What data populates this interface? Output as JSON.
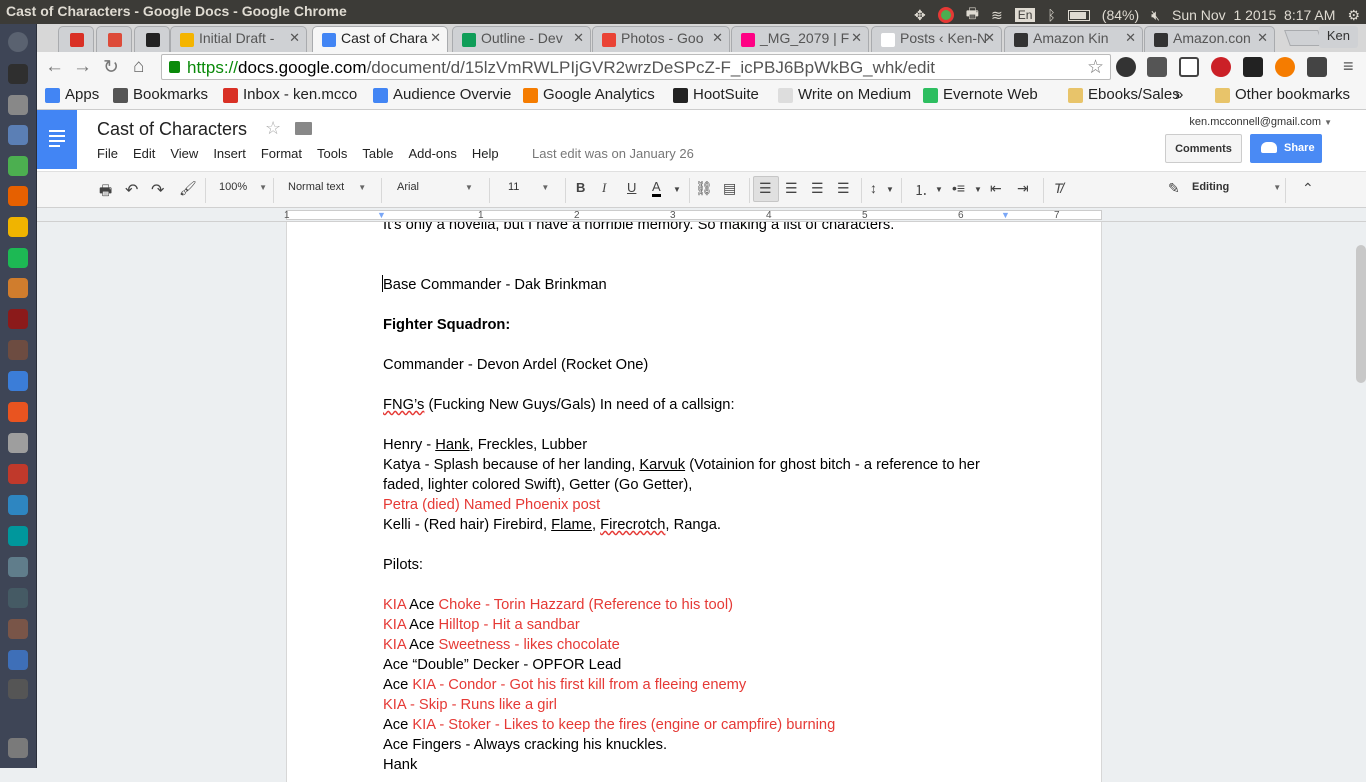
{
  "system_bar": {
    "window_title": "Cast of Characters - Google Docs - Google Chrome",
    "keyboard_layout": "En",
    "battery": "(84%)",
    "datetime": "Sun Nov  1 2015  8:17 AM",
    "user": "Ken"
  },
  "launcher": {
    "icons": [
      "ubuntu-dash-icon",
      "terminal-icon",
      "camera-icon",
      "files-icon",
      "chrome-icon",
      "firefox-icon",
      "pencil-app-icon",
      "spotify-icon",
      "sublime-icon",
      "scrivener-icon",
      "books-icon",
      "document-icon",
      "software-center-icon",
      "settings-icon",
      "calibre-icon",
      "graph-icon",
      "arduino-icon",
      "screenshot-icon",
      "camera-app-icon",
      "brush-icon",
      "notes-icon",
      "small-app-icon",
      "trash-icon"
    ],
    "colors": [
      "#5a6270",
      "#2f2f2f",
      "#888888",
      "#5b7fb5",
      "#4caf50",
      "#e66000",
      "#f0b400",
      "#1db954",
      "#d07d2d",
      "#8b1a1a",
      "#6d4c41",
      "#3b7dd8",
      "#e95420",
      "#9e9e9e",
      "#c0392b",
      "#2e86c1",
      "#00979c",
      "#607d8b",
      "#455a64",
      "#795548",
      "#3e6fb8",
      "#555555",
      "#7a7a7a"
    ]
  },
  "browser": {
    "tabs": [
      {
        "label": "",
        "favicon": "gmail-icon",
        "color": "#d93025"
      },
      {
        "label": "",
        "favicon": "google-plus-icon",
        "color": "#dd4b39"
      },
      {
        "label": "",
        "favicon": "owl-icon",
        "color": "#222222"
      },
      {
        "label": "Initial Draft -",
        "favicon": "drive-icon",
        "color": "#f4b400"
      },
      {
        "label": "Cast of Chara",
        "favicon": "docs-icon",
        "color": "#4285f4"
      },
      {
        "label": "Outline - Dev",
        "favicon": "sheets-icon",
        "color": "#0f9d58"
      },
      {
        "label": "Photos - Goo",
        "favicon": "photos-icon",
        "color": "#ea4335"
      },
      {
        "label": "_MG_2079 | F",
        "favicon": "flickr-icon",
        "color": "#ff0084"
      },
      {
        "label": "Posts ‹ Ken-N",
        "favicon": "page-icon",
        "color": "#ffffff"
      },
      {
        "label": "Amazon Kin",
        "favicon": "amazon-icon",
        "color": "#333333"
      },
      {
        "label": "Amazon.con",
        "favicon": "amazon-icon",
        "color": "#333333"
      }
    ],
    "url_scheme": "https://",
    "url_host": "docs.google.com",
    "url_path": "/document/d/15lzVmRWLPIjGVR2wrzDeSPcZ-F_icPBJ6BpWkBG_whk/edit",
    "bookmarks": [
      {
        "label": "Apps",
        "icon": "apps-grid-icon",
        "color": "#4285f4"
      },
      {
        "label": "Bookmarks",
        "icon": "star-icon",
        "color": "#555555"
      },
      {
        "label": "Inbox - ken.mcco",
        "icon": "gmail-icon",
        "color": "#d93025"
      },
      {
        "label": "Audience Overvie",
        "icon": "google-icon",
        "color": "#4285f4"
      },
      {
        "label": "Google Analytics",
        "icon": "analytics-icon",
        "color": "#f57c00"
      },
      {
        "label": "HootSuite",
        "icon": "hootsuite-icon",
        "color": "#222222"
      },
      {
        "label": "Write on Medium",
        "icon": "page-icon",
        "color": "#dddddd"
      },
      {
        "label": "Evernote Web",
        "icon": "evernote-icon",
        "color": "#2dbe60"
      },
      {
        "label": "Ebooks/Sales",
        "icon": "folder-icon",
        "color": "#e8c46a"
      }
    ],
    "overflow_label": "»",
    "other_bookmarks": "Other bookmarks"
  },
  "docs": {
    "title": "Cast of Characters",
    "menu": [
      "File",
      "Edit",
      "View",
      "Insert",
      "Format",
      "Tools",
      "Table",
      "Add-ons",
      "Help"
    ],
    "last_edit": "Last edit was on January 26",
    "account": "ken.mcconnell@gmail.com",
    "comments_label": "Comments",
    "share_label": "Share",
    "zoom": "100%",
    "style": "Normal text",
    "font": "Arial",
    "font_size": "11",
    "mode": "Editing",
    "ruler_numbers": [
      "1",
      "1",
      "2",
      "3",
      "4",
      "5",
      "6",
      "7"
    ],
    "accent": "#4285f4"
  },
  "document": {
    "l1": "It’s only a novella, but I have a horrible memory. So making a list of characters.",
    "l2": "Base Commander - Dak Brinkman",
    "l3": "Fighter Squadron:",
    "l4": "Commander - Devon Ardel (Rocket One)",
    "l5a": "FNG’s",
    "l5b": " (Fucking New Guys/Gals) In need of a callsign:",
    "l6a": "Henry - ",
    "l6b": "Hank",
    "l6c": ", Freckles, Lubber",
    "l7a": "Katya - Splash because of her landing, ",
    "l7b": "Karvuk",
    "l7c": " (Votainion for ghost bitch - a reference to her faded, lighter colored Swift), Getter (Go Getter),",
    "l8": "Petra (died) Named Phoenix post",
    "l9a": "Kelli - (Red hair) Firebird, ",
    "l9b": "Flame",
    "l9c": ", ",
    "l9d": "Firecrotch",
    "l9e": ", Ranga.",
    "l10": "Pilots:",
    "l11a": "KIA",
    "l11b": " Ace ",
    "l11c": "Choke - Torin Hazzard (Reference to his tool)",
    "l12a": "KIA",
    "l12b": " Ace ",
    "l12c": "Hilltop - Hit a sandbar",
    "l13a": "KIA",
    "l13b": " Ace ",
    "l13c": "Sweetness - likes chocolate",
    "l14": "Ace “Double” Decker - OPFOR Lead",
    "l15a": "Ace ",
    "l15b": "KIA - Condor - Got his first kill from a fleeing enemy",
    "l16": "KIA - Skip - Runs like a girl",
    "l17a": "Ace ",
    "l17b": "KIA - Stoker - Likes to keep the fires (engine or campfire) burning",
    "l18": "Ace Fingers - Always cracking his knuckles.",
    "l19": "Hank"
  }
}
